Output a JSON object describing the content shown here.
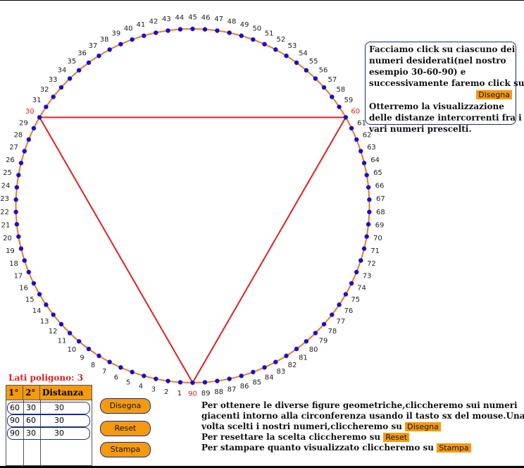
{
  "circle": {
    "numbers_count": 90,
    "selected": [
      30,
      60,
      90
    ],
    "colors": {
      "circle": "#f07820",
      "dot": "#1010d8",
      "polygon": "#e0201c",
      "selected_label": "#e0201c"
    }
  },
  "info": {
    "line1": "Facciamo click su ciascuno dei",
    "line2": "numeri desiderati(nel nostro",
    "line3": "esempio 30-60-90) e",
    "line4": "successivamente faremo click su",
    "tag": "Disegna",
    "line5": "Otterremo la visualizzazione",
    "line6": "delle distanze intercorrenti fra i",
    "line7": "vari numeri prescelti."
  },
  "polygon_sides": "Lati poligono: 3",
  "table": {
    "headers": [
      "1°",
      "2°",
      "Distanza"
    ],
    "rows": [
      [
        "60",
        "30",
        "30"
      ],
      [
        "90",
        "60",
        "30"
      ],
      [
        "90",
        "30",
        "30"
      ]
    ]
  },
  "buttons": {
    "draw": "Disegna",
    "reset": "Reset",
    "print": "Stampa"
  },
  "instructions": {
    "line1": "Per ottenere le diverse figure geometriche,cliccheremo sui numeri",
    "line2": "giacenti intorno alla circonferenza usando il tasto sx del mouse.Una",
    "line3a": "volta scelti i nostri numeri,cliccheremo su",
    "tag_draw": "Disegna",
    "line4a": "Per resettare la scelta cliccheremo su",
    "tag_reset": "Reset",
    "line5a": "Per stampare quanto visualizzato cliccheremo su",
    "tag_print": "Stampa"
  }
}
